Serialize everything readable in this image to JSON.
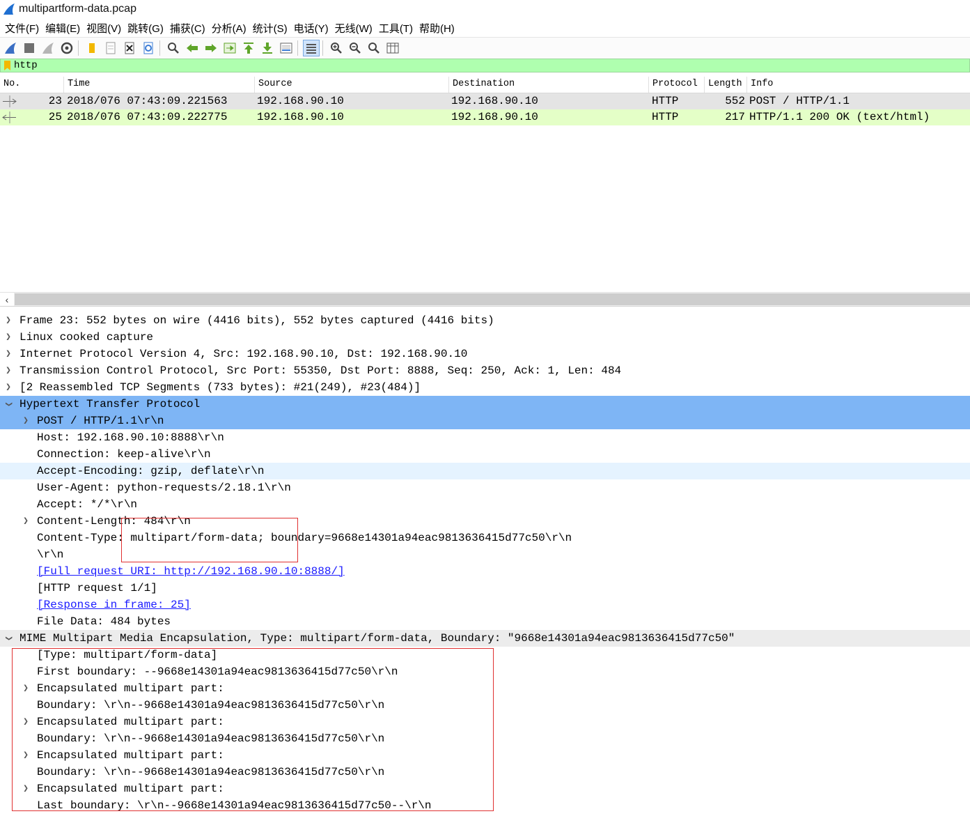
{
  "window": {
    "title": "multipartform-data.pcap"
  },
  "menu": [
    "文件(F)",
    "编辑(E)",
    "视图(V)",
    "跳转(G)",
    "捕获(C)",
    "分析(A)",
    "统计(S)",
    "电话(Y)",
    "无线(W)",
    "工具(T)",
    "帮助(H)"
  ],
  "filter": {
    "value": "http"
  },
  "columns": [
    "No.",
    "Time",
    "Source",
    "Destination",
    "Protocol",
    "Length",
    "Info"
  ],
  "packets": [
    {
      "no": "23",
      "time": "2018/076 07:43:09.221563",
      "source": "192.168.90.10",
      "destination": "192.168.90.10",
      "protocol": "HTTP",
      "length": "552",
      "info": "POST / HTTP/1.1"
    },
    {
      "no": "25",
      "time": "2018/076 07:43:09.222775",
      "source": "192.168.90.10",
      "destination": "192.168.90.10",
      "protocol": "HTTP",
      "length": "217",
      "info": "HTTP/1.1 200 OK  (text/html)"
    }
  ],
  "details": [
    {
      "text": "Frame 23: 552 bytes on wire (4416 bits), 552 bytes captured (4416 bits)"
    },
    {
      "text": "Linux cooked capture"
    },
    {
      "text": "Internet Protocol Version 4, Src: 192.168.90.10, Dst: 192.168.90.10"
    },
    {
      "text": "Transmission Control Protocol, Src Port: 55350, Dst Port: 8888, Seq: 250, Ack: 1, Len: 484"
    },
    {
      "text": "[2 Reassembled TCP Segments (733 bytes): #21(249), #23(484)]"
    },
    {
      "text": "Hypertext Transfer Protocol"
    },
    {
      "text": "POST / HTTP/1.1\\r\\n"
    },
    {
      "text": "Host: 192.168.90.10:8888\\r\\n"
    },
    {
      "text": "Connection: keep-alive\\r\\n"
    },
    {
      "text": "Accept-Encoding: gzip, deflate\\r\\n"
    },
    {
      "text": "User-Agent: python-requests/2.18.1\\r\\n"
    },
    {
      "text": "Accept: */*\\r\\n"
    },
    {
      "text": "Content-Length: 484\\r\\n"
    },
    {
      "text": "Content-Type: multipart/form-data; boundary=9668e14301a94eac9813636415d77c50\\r\\n"
    },
    {
      "text": "\\r\\n"
    },
    {
      "text": "[Full request URI: http://192.168.90.10:8888/]"
    },
    {
      "text": "[HTTP request 1/1]"
    },
    {
      "text": "[Response in frame: 25]"
    },
    {
      "text": "File Data: 484 bytes"
    },
    {
      "text": "MIME Multipart Media Encapsulation, Type: multipart/form-data, Boundary: \"9668e14301a94eac9813636415d77c50\""
    },
    {
      "text": "[Type: multipart/form-data]"
    },
    {
      "text": "First boundary: --9668e14301a94eac9813636415d77c50\\r\\n"
    },
    {
      "text": "Encapsulated multipart part:"
    },
    {
      "text": "Boundary: \\r\\n--9668e14301a94eac9813636415d77c50\\r\\n"
    },
    {
      "text": "Encapsulated multipart part:"
    },
    {
      "text": "Boundary: \\r\\n--9668e14301a94eac9813636415d77c50\\r\\n"
    },
    {
      "text": "Encapsulated multipart part:"
    },
    {
      "text": "Boundary: \\r\\n--9668e14301a94eac9813636415d77c50\\r\\n"
    },
    {
      "text": "Encapsulated multipart part:"
    },
    {
      "text": "Last boundary: \\r\\n--9668e14301a94eac9813636415d77c50--\\r\\n"
    }
  ]
}
